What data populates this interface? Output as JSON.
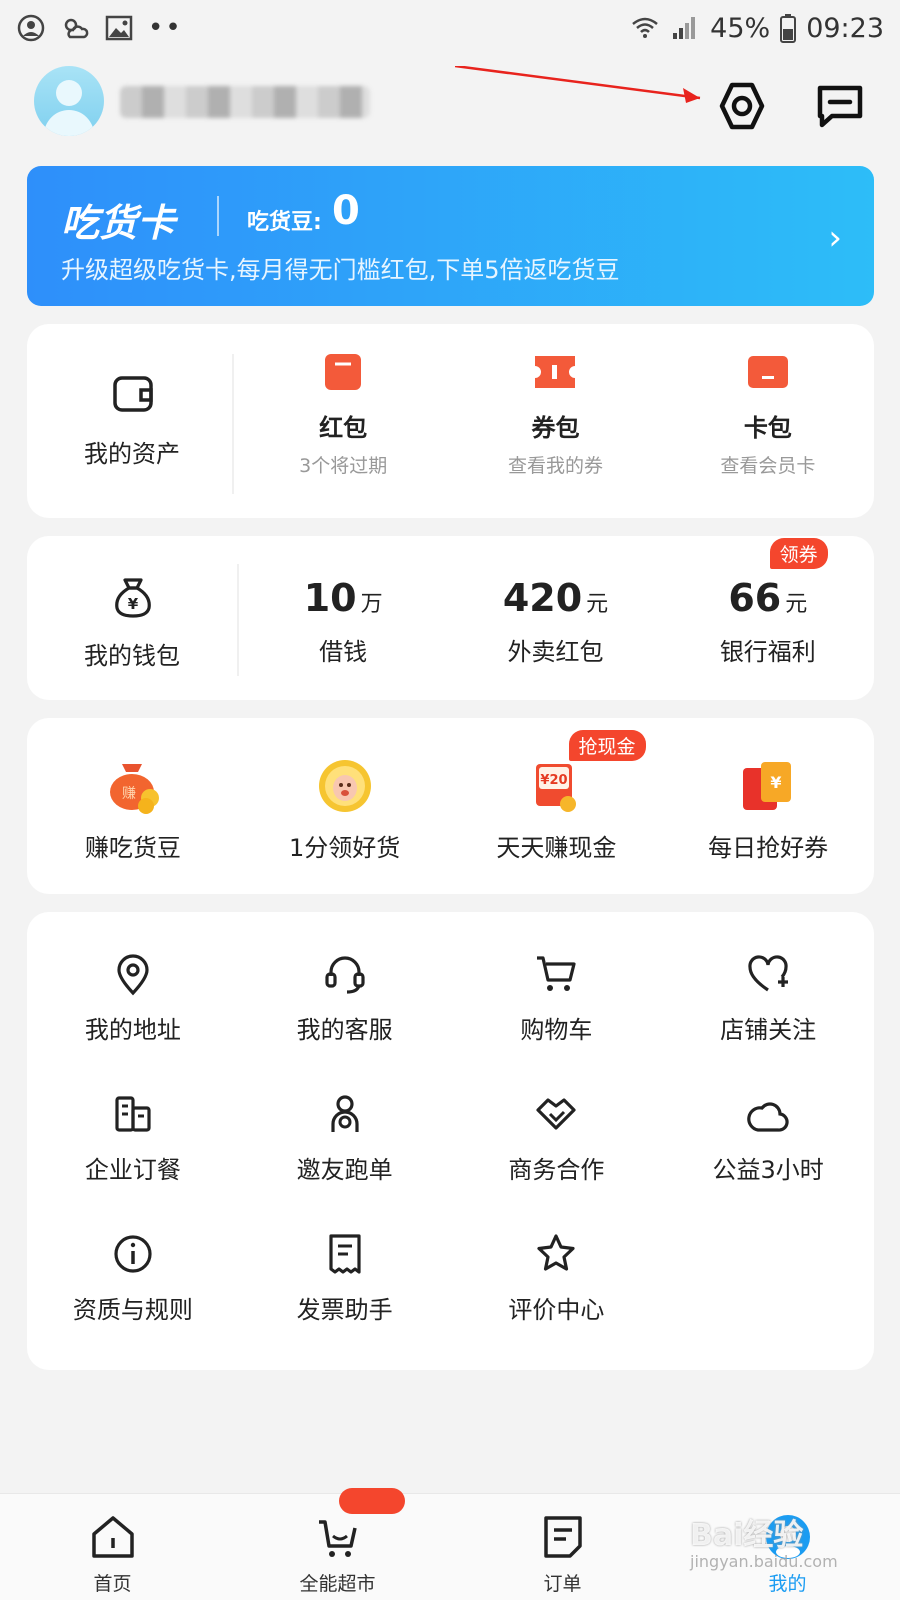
{
  "status_bar": {
    "battery": "45%",
    "time": "09:23"
  },
  "vip_card": {
    "title": "吃货卡",
    "bean_label": "吃货豆:",
    "bean_value": "0",
    "description": "升级超级吃货卡,每月得无门槛红包,下单5倍返吃货豆"
  },
  "assets": {
    "label": "我的资产",
    "items": [
      {
        "title": "红包",
        "sub": "3个将过期"
      },
      {
        "title": "券包",
        "sub": "查看我的券"
      },
      {
        "title": "卡包",
        "sub": "查看会员卡"
      }
    ]
  },
  "wallet": {
    "label": "我的钱包",
    "items": [
      {
        "num": "10",
        "unit": "万",
        "label": "借钱"
      },
      {
        "num": "420",
        "unit": "元",
        "label": "外卖红包"
      },
      {
        "num": "66",
        "unit": "元",
        "label": "银行福利",
        "badge": "领券"
      }
    ]
  },
  "promos": [
    {
      "label": "赚吃货豆"
    },
    {
      "label": "1分领好货"
    },
    {
      "label": "天天赚现金",
      "badge": "抢现金",
      "coupon": "¥20"
    },
    {
      "label": "每日抢好券"
    }
  ],
  "services": [
    {
      "label": "我的地址"
    },
    {
      "label": "我的客服"
    },
    {
      "label": "购物车"
    },
    {
      "label": "店铺关注"
    },
    {
      "label": "企业订餐"
    },
    {
      "label": "邀友跑单"
    },
    {
      "label": "商务合作"
    },
    {
      "label": "公益3小时"
    },
    {
      "label": "资质与规则"
    },
    {
      "label": "发票助手"
    },
    {
      "label": "评价中心"
    }
  ],
  "tabbar": [
    {
      "label": "首页"
    },
    {
      "label": "全能超市"
    },
    {
      "label": "订单"
    },
    {
      "label": "我的"
    }
  ],
  "watermark": {
    "brand": "Bai经验",
    "url": "jingyan.baidu.com"
  },
  "colors": {
    "accent_blue": "#2e8ffa",
    "accent_red": "#f4462d",
    "active_tab": "#1a9cf2"
  }
}
